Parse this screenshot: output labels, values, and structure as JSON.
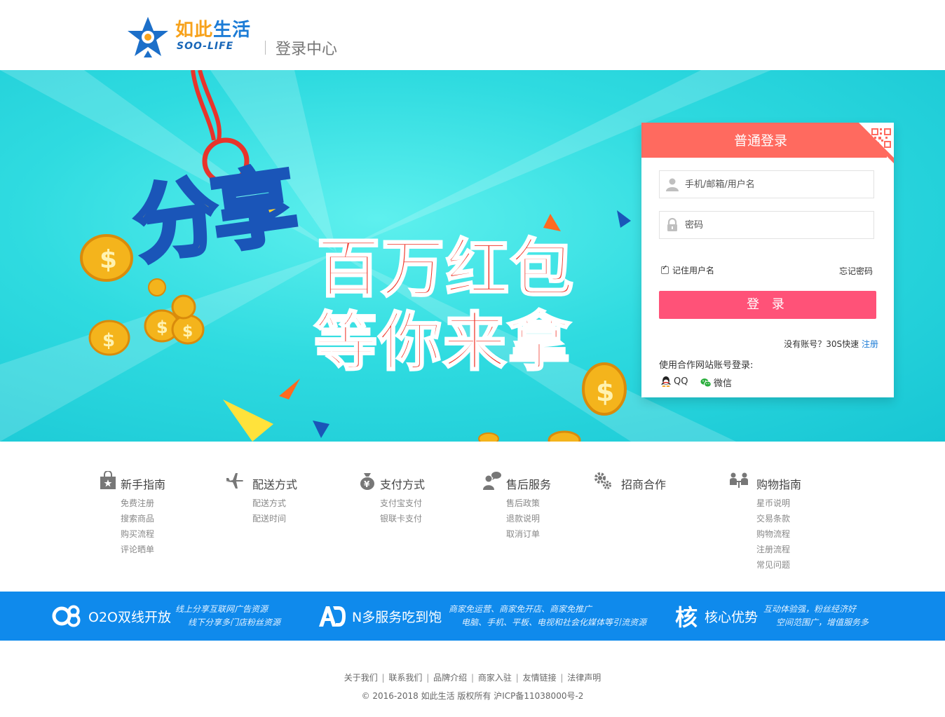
{
  "header": {
    "logo_cn_1": "如此",
    "logo_cn_2": "生活",
    "logo_en": "SOO-LIFE",
    "title": "登录中心"
  },
  "banner": {
    "headline": "分享",
    "line1": "百万红包",
    "line2": "等你来拿"
  },
  "login": {
    "tab_label": "普通登录",
    "username_placeholder": "手机/邮箱/用户名",
    "password_placeholder": "密码",
    "remember_label": "记住用户名",
    "remember_checked": true,
    "forgot_label": "忘记密码",
    "submit_label": "登 录",
    "no_account_text": "没有账号？30S快速",
    "register_link": "注册",
    "partner_text": "使用合作网站账号登录:",
    "qq_label": "QQ",
    "wechat_label": "微信"
  },
  "guide": {
    "columns": [
      {
        "title": "新手指南",
        "icon": "shopping-bag-icon",
        "items": [
          "免费注册",
          "搜索商品",
          "购买流程",
          "评论晒单"
        ]
      },
      {
        "title": "配送方式",
        "icon": "airplane-icon",
        "items": [
          "配送方式",
          "配送时间"
        ]
      },
      {
        "title": "支付方式",
        "icon": "money-bag-icon",
        "items": [
          "支付宝支付",
          "银联卡支付"
        ]
      },
      {
        "title": "售后服务",
        "icon": "customer-service-icon",
        "items": [
          "售后政策",
          "退款说明",
          "取消订单"
        ]
      },
      {
        "title": "招商合作",
        "icon": "gears-icon",
        "items": []
      },
      {
        "title": "购物指南",
        "icon": "people-icon",
        "items": [
          "星币说明",
          "交易条款",
          "购物流程",
          "注册流程",
          "常见问题"
        ]
      }
    ]
  },
  "strip": {
    "items": [
      {
        "icon_text": "O8",
        "title": "O2O双线开放",
        "desc1": "线上分享互联网广告资源",
        "desc2": "线下分享多门店粉丝资源"
      },
      {
        "icon_text": "AD",
        "title": "N多服务吃到饱",
        "desc1": "商家免运营、商家免开店、商家免推广",
        "desc2": "电脑、手机、平板、电视和社会化媒体等引流资源"
      },
      {
        "icon_text": "核",
        "title": "核心优势",
        "desc1": "互动体验强，粉丝经济好",
        "desc2": "空间范围广，增值服务多"
      }
    ]
  },
  "footer": {
    "links": [
      "关于我们",
      "联系我们",
      "品牌介绍",
      "商家入驻",
      "友情链接",
      "法律声明"
    ],
    "separator": "|",
    "copyright": "© 2016-2018 如此生活 版权所有 沪ICP备11038000号-2"
  },
  "colors": {
    "banner_bg": "#2fdbe0",
    "login_tab": "#ff6a5f",
    "login_button": "#ff5278",
    "strip_bg": "#0f8aec",
    "link": "#1c7cd6"
  }
}
